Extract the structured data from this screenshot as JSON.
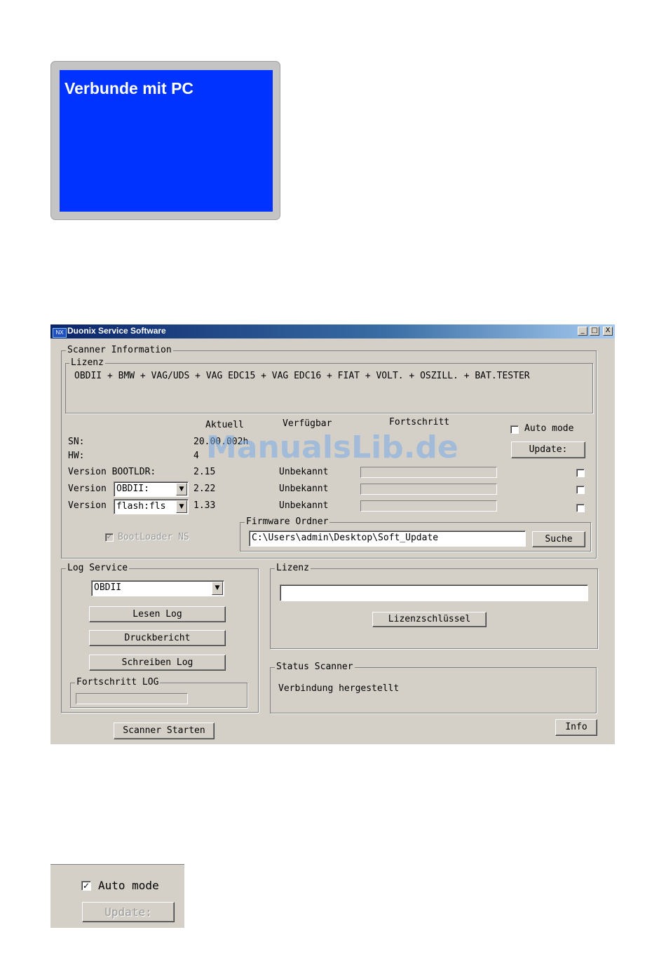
{
  "device": {
    "screen_text": "Verbunde mit PC",
    "screen_color": "#0033ff"
  },
  "window": {
    "title": "Duonix Service Software",
    "icon_text": "NX",
    "controls": {
      "minimize": "_",
      "maximize": "□",
      "close": "X"
    },
    "scanner_info": {
      "label": "Scanner Information",
      "lizenz": {
        "label": "Lizenz",
        "text": "OBDII + BMW + VAG/UDS + VAG EDC15 + VAG EDC16 + FIAT + VOLT. + OSZILL. + BAT.TESTER"
      },
      "headers": {
        "aktuell": "Aktuell",
        "verfuegbar": "Verfügbar",
        "fortschritt": "Fortschritt"
      },
      "auto_mode": {
        "label": "Auto mode",
        "checked": false
      },
      "update_button": "Update:",
      "rows": {
        "sn": {
          "label": "SN:",
          "value": "20.00.002h"
        },
        "hw": {
          "label": "HW:",
          "value": "4"
        },
        "bootldr": {
          "label": "Version BOOTLDR:",
          "aktuell": "2.15",
          "verfuegbar": "Unbekannt",
          "progress": 0
        },
        "obdii": {
          "label": "Version",
          "select": "OBDII:",
          "aktuell": "2.22",
          "verfuegbar": "Unbekannt",
          "progress": 0
        },
        "flash": {
          "label": "Version",
          "select": "flash:fls",
          "aktuell": "1.33",
          "verfuegbar": "Unbekannt",
          "progress": 0
        }
      },
      "bootloader_ns": {
        "label": "BootLoader NS",
        "checked": true,
        "enabled": false
      },
      "firmware": {
        "label": "Firmware Ordner",
        "path": "C:\\Users\\admin\\Desktop\\Soft_Update",
        "search_button": "Suche"
      }
    },
    "log_service": {
      "label": "Log Service",
      "select": "OBDII",
      "buttons": {
        "read": "Lesen Log",
        "print": "Druckbericht",
        "write": "Schreiben Log"
      },
      "progress_label": "Fortschritt  LOG",
      "progress": 0
    },
    "license_panel": {
      "label": "Lizenz",
      "input": "",
      "key_button": "Lizenzschlüssel"
    },
    "status": {
      "label": "Status Scanner",
      "text": "Verbindung hergestellt"
    },
    "start_button": "Scanner Starten",
    "info_button": "Info"
  },
  "watermark": "ManualsLib.de",
  "inset": {
    "auto_mode_label": "Auto mode",
    "auto_mode_checked": true,
    "update_button": "Update:"
  }
}
